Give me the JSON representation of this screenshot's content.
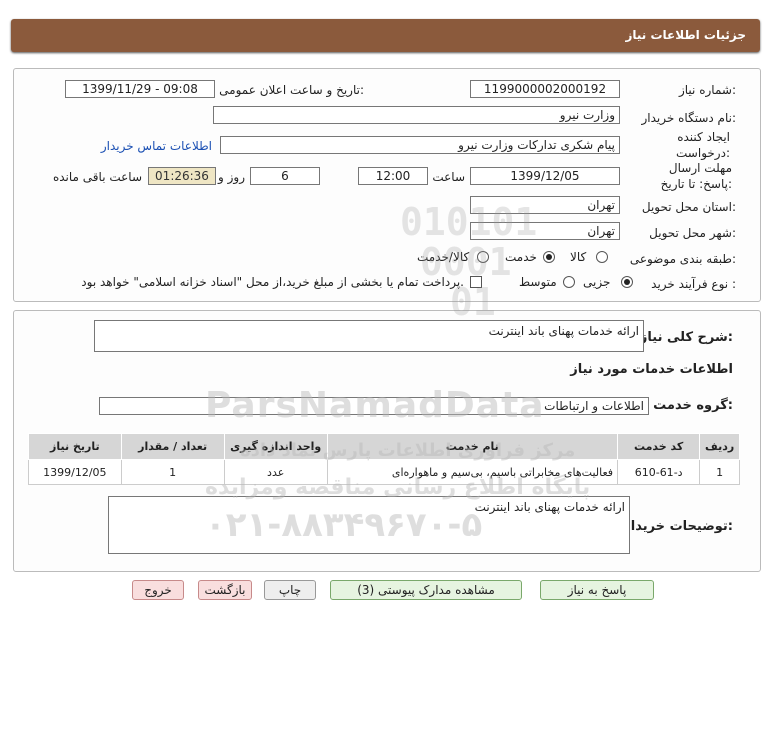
{
  "header": {
    "title": "جزئیات اطلاعات نیاز"
  },
  "fields": {
    "need_number_label": "شماره نیاز:",
    "need_number": "1199000002000192",
    "announce_label": "تاریخ و ساعت اعلان عمومی:",
    "announce_value": "1399/11/29 - 09:08",
    "buyer_org_label": "نام دستگاه خریدار:",
    "buyer_org": "وزارت نیرو",
    "creator_label": "ایجاد کننده درخواست:",
    "creator": "پیام شکری تدارکات وزارت نیرو",
    "contact_link": "اطلاعات تماس خریدار",
    "deadline_label": "مهلت ارسال پاسخ: تا تاریخ:",
    "deadline_date": "1399/12/05",
    "time_label": "ساعت",
    "deadline_time": "12:00",
    "days_value": "6",
    "days_label": "روز و",
    "remaining_time": "01:26:36",
    "remaining_label": "ساعت باقی مانده",
    "province_label": "استان محل تحویل:",
    "province": "تهران",
    "city_label": "شهر محل تحویل:",
    "city": "تهران",
    "category_label": "طبقه بندی موضوعی:",
    "category_options": [
      "کالا",
      "خدمت",
      "کالا/خدمت"
    ],
    "category_selected": "خدمت",
    "process_label": "نوع فرآیند خرید :",
    "process_options": [
      "جزیی",
      "متوسط"
    ],
    "process_selected": "جزیی",
    "payment_note": "پرداخت تمام یا بخشی از مبلغ خرید،از محل \"اسناد خزانه اسلامی\" خواهد بود."
  },
  "summary": {
    "desc_label": "شرح کلی نیاز:",
    "desc_value": "ارائه خدمات پهنای باند اینترنت",
    "services_heading": "اطلاعات خدمات مورد نیاز",
    "group_label": "گروه خدمت:",
    "group_value": "اطلاعات و ارتباطات"
  },
  "table": {
    "headers": [
      "ردیف",
      "کد خدمت",
      "نام خدمت",
      "واحد اندازه گیری",
      "تعداد / مقدار",
      "تاریخ نیاز"
    ],
    "rows": [
      [
        "1",
        "د-61-610",
        "فعالیت‌های مخابراتی باسیم، بی‌سیم و ماهواره‌ای",
        "عدد",
        "1",
        "1399/12/05"
      ]
    ]
  },
  "buyer_notes": {
    "label": "توضیحات خریدار:",
    "value": "ارائه خدمات پهنای باند اینترنت"
  },
  "buttons": {
    "reply": "پاسخ به نیاز",
    "attachments": "مشاهده مدارک پیوستی (3)",
    "print": "چاپ",
    "back": "بازگشت",
    "exit": "خروج"
  },
  "watermark": {
    "line1": "ParsNamadData",
    "line2": "مرکز فراوری اطلاعات پارس نماد داده",
    "line3": "پایگاه اطلاع رسانی مناقصه ومزایده",
    "line4": "۰۲۱-۸۸۳۴۹۶۷۰-۵"
  },
  "colors": {
    "title_bg": "#8b5a3c",
    "timer_bg": "#efe6c4",
    "link": "#1a4fb3"
  }
}
